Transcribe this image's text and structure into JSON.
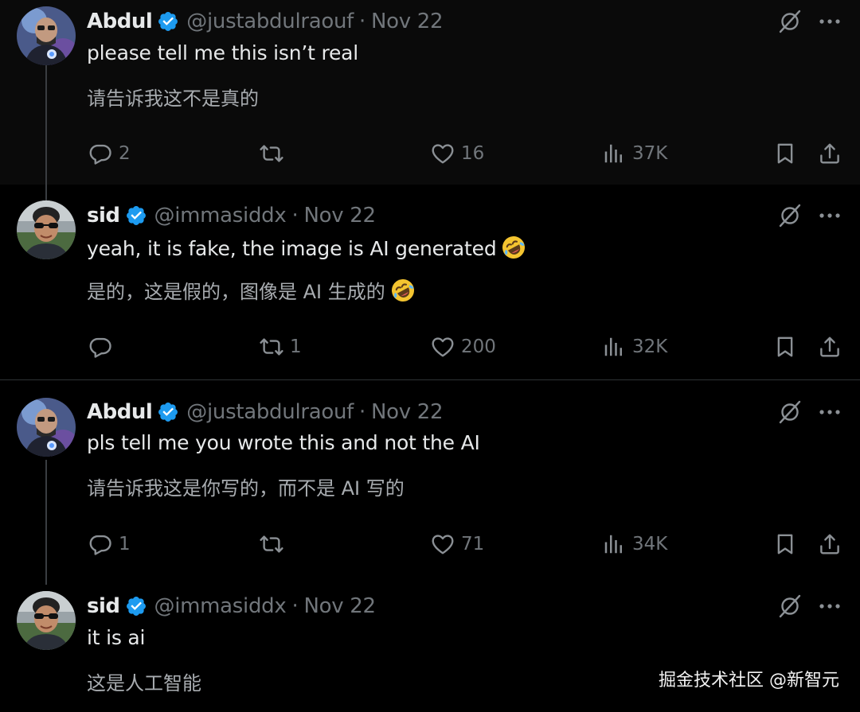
{
  "tweets": [
    {
      "name": "Abdul",
      "handle": "@justabdulraouf",
      "separator": "·",
      "date": "Nov 22",
      "text": "please tell me this isn’t real",
      "translation": "请告诉我这不是真的",
      "replies": "2",
      "reposts": "",
      "likes": "16",
      "views": "37K"
    },
    {
      "name": "sid",
      "handle": "@immasiddx",
      "separator": "·",
      "date": "Nov 22",
      "text": "yeah, it is fake, the image is AI generated",
      "translation": "是的，这是假的，图像是 AI 生成的",
      "replies": "",
      "reposts": "1",
      "likes": "200",
      "views": "32K"
    },
    {
      "name": "Abdul",
      "handle": "@justabdulraouf",
      "separator": "·",
      "date": "Nov 22",
      "text": "pls tell me you wrote this and not the AI",
      "translation": "请告诉我这是你写的，而不是 AI 写的",
      "replies": "1",
      "reposts": "",
      "likes": "71",
      "views": "34K"
    },
    {
      "name": "sid",
      "handle": "@immasiddx",
      "separator": "·",
      "date": "Nov 22",
      "text": "it is ai",
      "translation": "这是人工智能"
    }
  ],
  "watermark": "掘金技术社区 @新智元",
  "colors": {
    "background": "#000000",
    "highlight_background": "#0a0a0a",
    "verified": "#1d9bf0",
    "muted_text": "#71767b",
    "primary_text": "#e7e9ea",
    "translation_text": "#a8acb0"
  },
  "icons": {
    "verified": "verified-badge-icon",
    "grok": "grok-icon",
    "more": "more-icon",
    "reply": "reply-icon",
    "repost": "repost-icon",
    "like": "like-icon",
    "views": "views-icon",
    "bookmark": "bookmark-icon",
    "share": "share-icon",
    "emoji": "rolling-on-floor-laughing-emoji"
  }
}
